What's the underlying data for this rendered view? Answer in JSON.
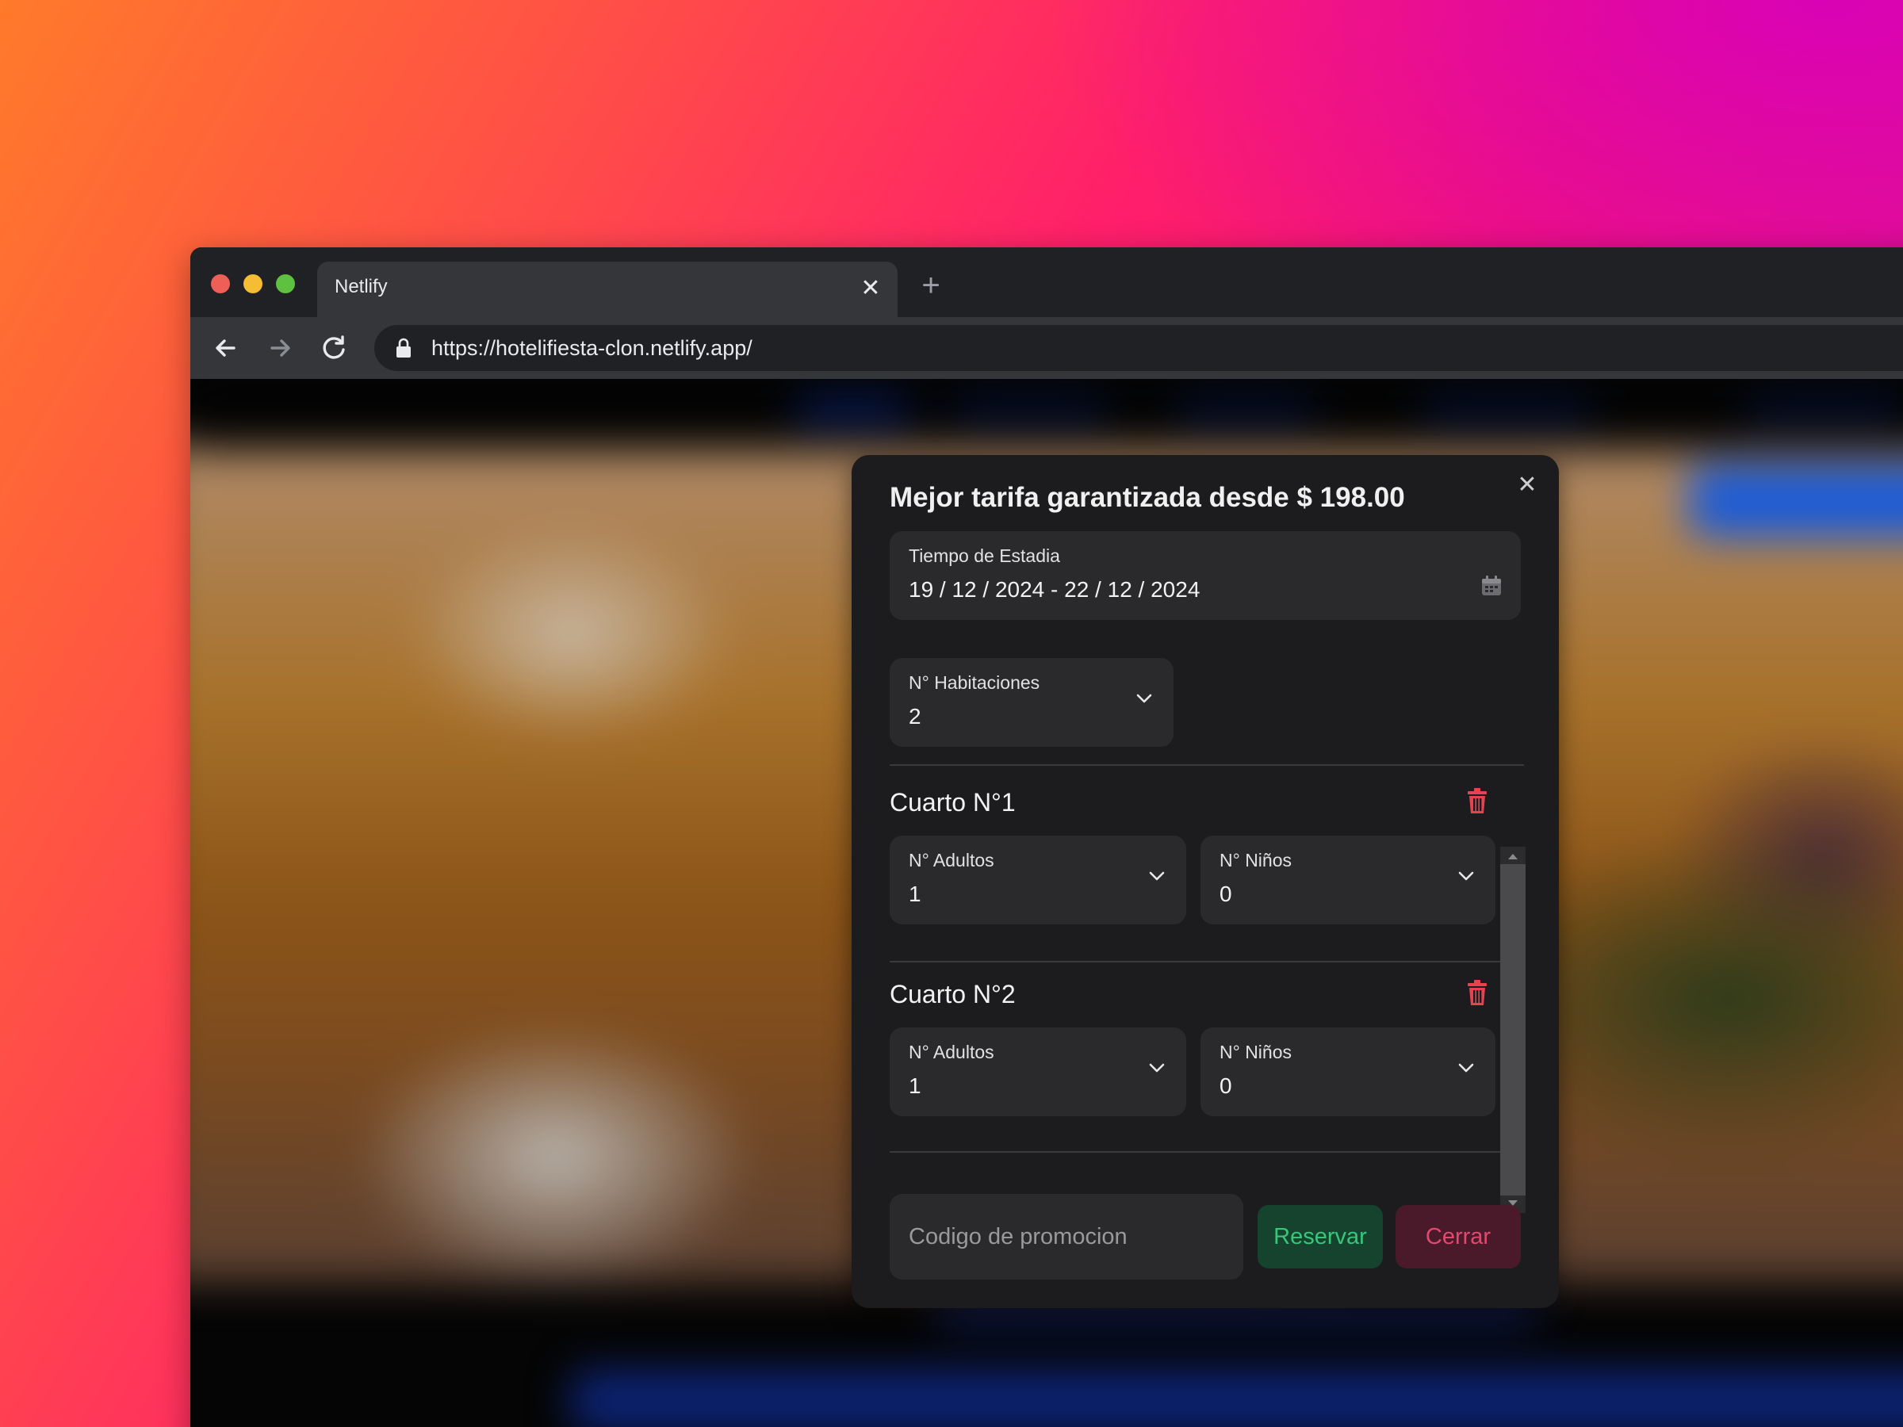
{
  "browser": {
    "tab_title": "Netlify",
    "url": "https://hotelifiesta-clon.netlify.app/"
  },
  "modal": {
    "title": "Mejor tarifa garantizada desde $ 198.00",
    "stay": {
      "label": "Tiempo de Estadia",
      "value": "19 / 12 / 2024  -  22 / 12 / 2024"
    },
    "rooms_select": {
      "label": "N° Habitaciones",
      "value": "2"
    },
    "rooms": [
      {
        "title": "Cuarto N°1",
        "adults_label": "N° Adultos",
        "adults_value": "1",
        "children_label": "N° Niños",
        "children_value": "0"
      },
      {
        "title": "Cuarto N°2",
        "adults_label": "N° Adultos",
        "adults_value": "1",
        "children_label": "N° Niños",
        "children_value": "0"
      }
    ],
    "promo_placeholder": "Codigo de promocion",
    "reserve_label": "Reservar",
    "close_label": "Cerrar"
  },
  "colors": {
    "reserve_text": "#38c77a",
    "close_text": "#e04a6e",
    "trash": "#e8414f"
  },
  "icons": [
    "close-icon",
    "plus-icon",
    "back-arrow-icon",
    "forward-arrow-icon",
    "reload-icon",
    "lock-icon",
    "calendar-icon",
    "chevron-down-icon",
    "trash-icon"
  ]
}
